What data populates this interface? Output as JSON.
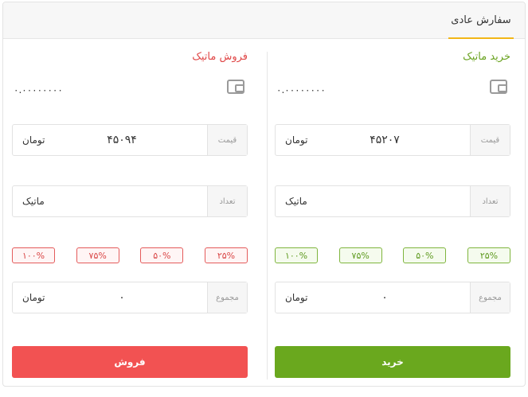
{
  "tab": {
    "label": "سفارش عادی"
  },
  "buy": {
    "title": "خرید ماتیک",
    "balance": "۰.۰۰۰۰۰۰۰۰",
    "price_label": "قیمت",
    "price_value": "۴۵۲۰۷",
    "price_unit": "تومان",
    "qty_label": "تعداد",
    "qty_unit": "ماتیک",
    "percents": [
      "۲۵%",
      "۵۰%",
      "۷۵%",
      "۱۰۰%"
    ],
    "total_label": "مجموع",
    "total_value": "۰",
    "total_unit": "تومان",
    "button": "خرید"
  },
  "sell": {
    "title": "فروش ماتیک",
    "balance": "۰.۰۰۰۰۰۰۰۰",
    "price_label": "قیمت",
    "price_value": "۴۵۰۹۴",
    "price_unit": "تومان",
    "qty_label": "تعداد",
    "qty_unit": "ماتیک",
    "percents": [
      "۲۵%",
      "۵۰%",
      "۷۵%",
      "۱۰۰%"
    ],
    "total_label": "مجموع",
    "total_value": "۰",
    "total_unit": "تومان",
    "button": "فروش"
  },
  "colors": {
    "tab_underline": "#f2b617",
    "buy_accent": "#6aa81e",
    "sell_accent": "#f25252"
  },
  "icons": {
    "wallet": "wallet-icon"
  }
}
